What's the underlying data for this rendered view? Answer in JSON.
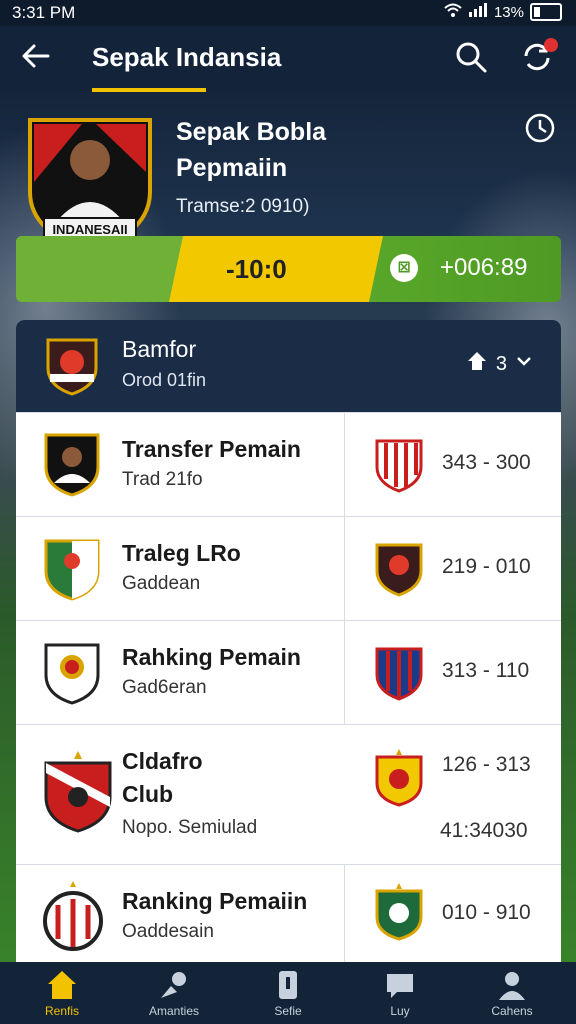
{
  "status": {
    "time": "3:31 PM",
    "battery": "13%"
  },
  "appbar": {
    "title": "Sepak Indansia"
  },
  "hero": {
    "title_line1": "Sepak Bobla",
    "title_line2": "Pepmaiin",
    "subtitle": "Tramse:2 0910)",
    "crest_text": "INDANESAII",
    "score": "-10:0",
    "odds": "+006:89"
  },
  "list": {
    "header": {
      "name": "Bamfor",
      "meta": "Orod 01fin",
      "count": "3"
    },
    "rows": [
      {
        "title": "Transfer Pemain",
        "subtitle": "Trad 21fo",
        "value": "343 - 300"
      },
      {
        "title": "Traleg LRo",
        "subtitle": "Gaddean",
        "value": "219 - 010"
      },
      {
        "title": "Rahking Pemain",
        "subtitle": "Gad6eran",
        "value": "313 - 110"
      },
      {
        "title_line1": "Cldafro",
        "title_line2": "Club",
        "subtitle": "Nopo. Semiulad",
        "value": "126 - 313",
        "value2": "41:34030"
      },
      {
        "title": "Ranking Pemaiin",
        "subtitle": "Oaddesain",
        "value": "010 - 910"
      }
    ]
  },
  "nav": [
    {
      "label": "Renfis",
      "icon": "home-icon"
    },
    {
      "label": "Amanties",
      "icon": "ball-kick-icon"
    },
    {
      "label": "Sefie",
      "icon": "phone-icon"
    },
    {
      "label": "Luy",
      "icon": "chat-icon"
    },
    {
      "label": "Cahens",
      "icon": "profile-icon"
    }
  ],
  "colors": {
    "accent": "#f2c200",
    "appbar": "#13243a",
    "score_green": "#5aa82a",
    "score_yellow": "#f2c800"
  }
}
